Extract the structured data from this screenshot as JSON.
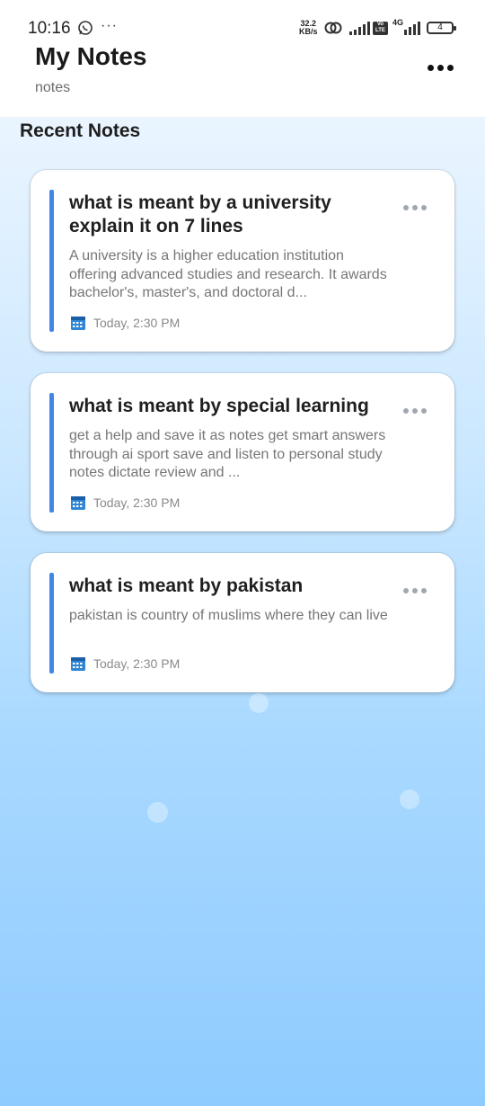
{
  "status_bar": {
    "time": "10:16",
    "dots": "···",
    "net_speed_value": "32.2",
    "net_speed_unit": "KB/s",
    "volte": "Vo LTE",
    "network_type": "4G",
    "battery": "4"
  },
  "header": {
    "title": "My Notes",
    "subtitle": "notes"
  },
  "section": {
    "title": "Recent Notes"
  },
  "notes": [
    {
      "title": "what is meant by a university explain it on 7 lines",
      "preview": "A university is a higher education institution offering advanced studies and research.  It awards bachelor's, master's, and doctoral d...",
      "date": "Today, 2:30 PM"
    },
    {
      "title": "what is meant by special learning",
      "preview": "get a help and save it as notes get smart answers through ai sport save and listen to personal study notes dictate review and ...",
      "date": "Today, 2:30 PM"
    },
    {
      "title": "what is meant by pakistan",
      "preview": "pakistan is country of muslims where they can live",
      "date": "Today, 2:30 PM"
    }
  ],
  "colors": {
    "accent": "#3f86e8",
    "background_top": "#f2f8ff",
    "background_bottom": "#8ecbff"
  }
}
